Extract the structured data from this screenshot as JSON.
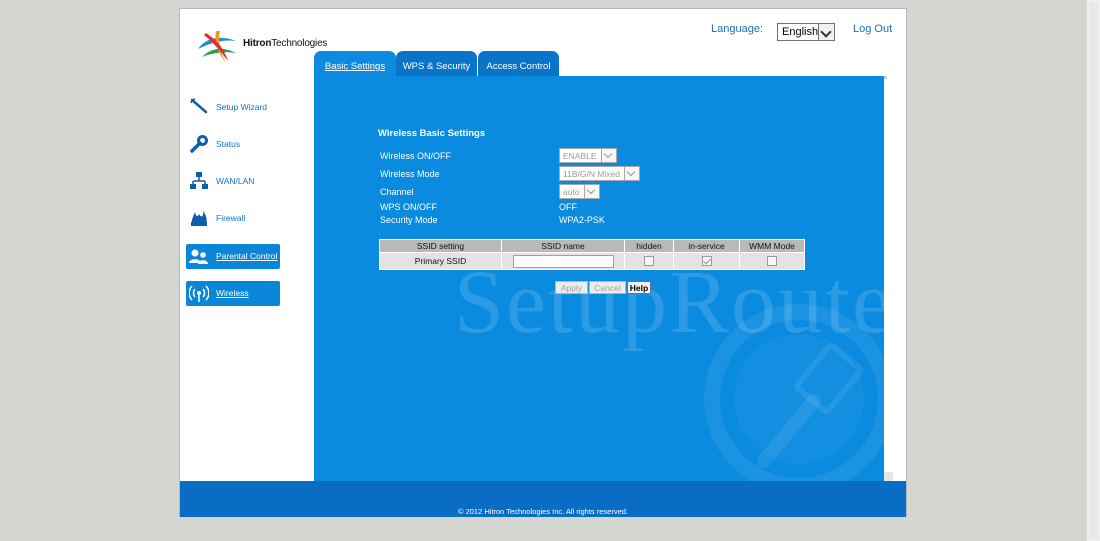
{
  "header": {
    "brand_bold": "Hitron",
    "brand_rest": "Technologies",
    "language_label": "Language:",
    "language_value": "English",
    "logout_label": "Log Out"
  },
  "tabs": [
    {
      "label": "Basic Settings",
      "active": true
    },
    {
      "label": "WPS & Security",
      "active": false
    },
    {
      "label": "Access Control",
      "active": false
    }
  ],
  "sidebar": {
    "items": [
      {
        "label": "Setup Wizard",
        "icon": "wand-icon",
        "active": false
      },
      {
        "label": "Status",
        "icon": "wrench-icon",
        "active": false
      },
      {
        "label": "WAN/LAN",
        "icon": "network-icon",
        "active": false
      },
      {
        "label": "Firewall",
        "icon": "firewall-icon",
        "active": false
      },
      {
        "label": "Parental Control",
        "icon": "users-icon",
        "active": true
      },
      {
        "label": "Wireless",
        "icon": "wireless-icon",
        "active": true
      }
    ]
  },
  "main": {
    "title": "Wireless Basic Settings",
    "wireless_onoff_label": "Wireless ON/OFF",
    "wireless_onoff_value": "ENABLE",
    "wireless_mode_label": "Wireless Mode",
    "wireless_mode_value": "11B/G/N Mixed",
    "channel_label": "Channel",
    "channel_value": "auto",
    "wps_label": "WPS ON/OFF",
    "wps_value": "OFF",
    "security_label": "Security Mode",
    "security_value": "WPA2-PSK",
    "table": {
      "headers": [
        "SSID setting",
        "SSID name",
        "hidden",
        "in-service",
        "WMM Mode"
      ],
      "rows": [
        {
          "setting": "Primary SSID",
          "name": "",
          "hidden": false,
          "in_service": true,
          "wmm": false
        }
      ]
    },
    "buttons": {
      "apply": "Apply",
      "cancel": "Cancel",
      "help": "Help"
    }
  },
  "watermark": "SetupRouter.com",
  "footer": {
    "copyright": "© 2012 Hitron Technologies Inc.  All rights reserved."
  },
  "colors": {
    "panel": "#0a8be0",
    "tab": "#0a74c9",
    "footer": "#0a6dc5",
    "link": "#1b6fb8"
  }
}
